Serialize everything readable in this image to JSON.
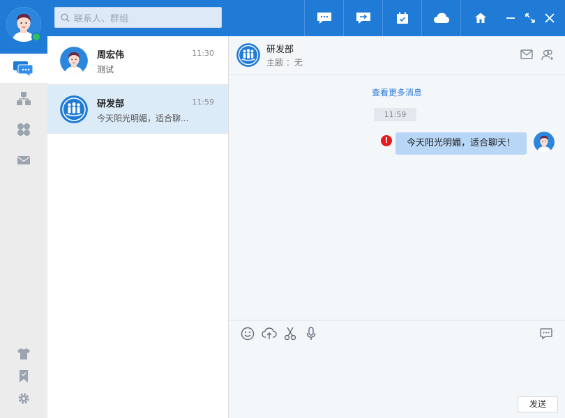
{
  "app": {
    "colors": {
      "primary": "#1f7bd6",
      "online": "#2fc25b",
      "warning": "#e61c1c",
      "bubble": "#b8d6f6",
      "link": "#2c7ad6"
    }
  },
  "user": {
    "avatar_icon": "male-avatar-icon",
    "status": "online"
  },
  "sidebar": {
    "items": [
      {
        "icon": "chat-bubbles-icon",
        "active": true
      },
      {
        "icon": "org-structure-icon",
        "active": false
      },
      {
        "icon": "apps-grid-icon",
        "active": false
      },
      {
        "icon": "mail-icon",
        "active": false
      }
    ],
    "bottom": [
      {
        "icon": "skin-shirt-icon"
      },
      {
        "icon": "bookmark-icon"
      },
      {
        "icon": "settings-gear-icon"
      }
    ]
  },
  "search": {
    "placeholder": "联系人、群组"
  },
  "toolbar": {
    "buttons": [
      "message-icon",
      "forward-icon",
      "calendar-icon",
      "cloud-icon",
      "home-icon"
    ],
    "window": [
      "minimize-icon",
      "maximize-icon",
      "close-icon"
    ]
  },
  "conversations": [
    {
      "name": "周宏伟",
      "time": "11:30",
      "last_message": "测试",
      "avatar": "male-avatar-icon",
      "selected": false
    },
    {
      "name": "研发部",
      "time": "11:59",
      "last_message": "今天阳光明媚，适合聊...",
      "avatar": "group-icon",
      "selected": true
    }
  ],
  "chat": {
    "title": "研发部",
    "topic": "主题 ：无",
    "more_messages": "查看更多消息",
    "messages": [
      {
        "time": "11:59",
        "text": "今天阳光明媚，适合聊天！",
        "failed": true,
        "failed_mark": "!"
      }
    ],
    "tools": [
      "emoji-icon",
      "upload-icon",
      "scissors-icon",
      "microphone-icon"
    ],
    "send_label": "发送"
  }
}
